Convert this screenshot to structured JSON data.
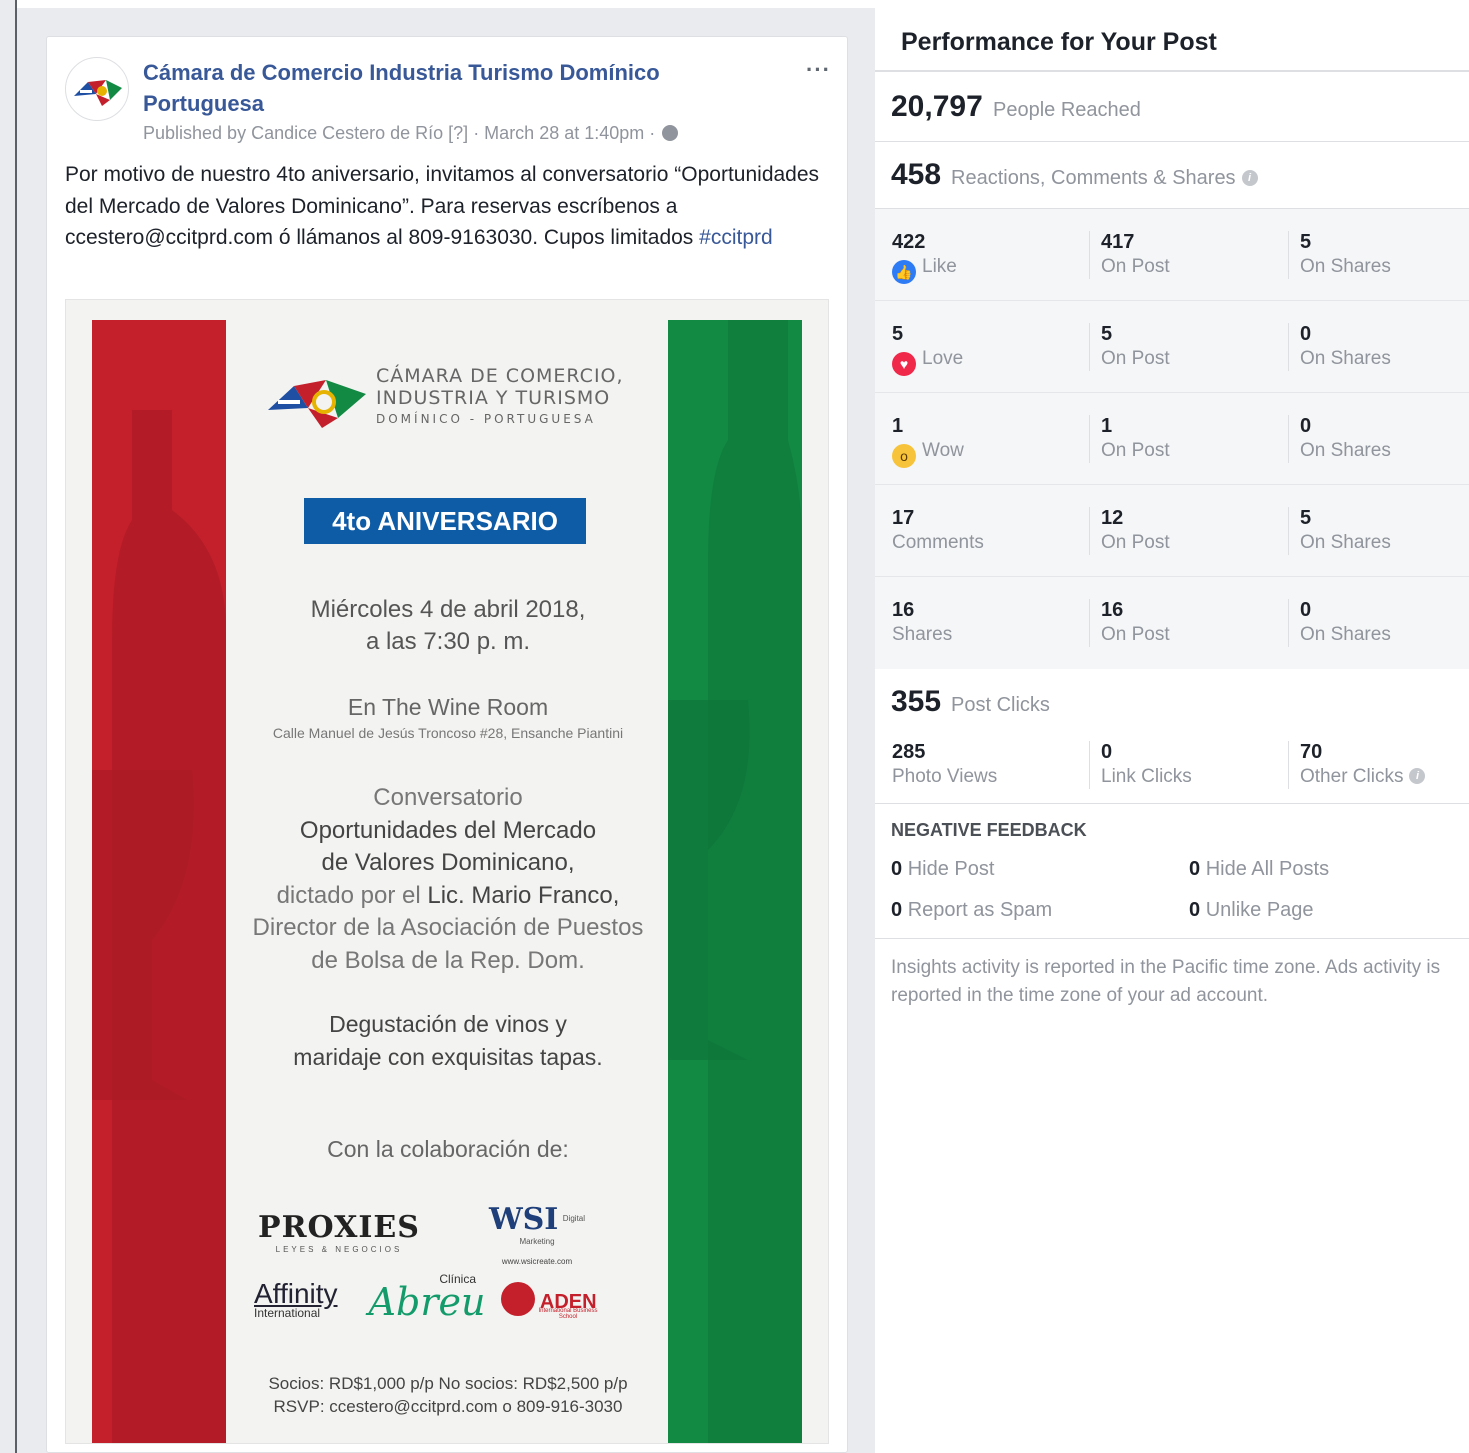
{
  "post": {
    "page_name": "Cámara de Comercio Industria Turismo Domínico Portuguesa",
    "published_by": "Published by Candice Cestero de Río [?] · March 28 at 1:40pm · ",
    "more_label": "···",
    "text": "Por motivo de nuestro 4to aniversario, invitamos al conversatorio “Oportunidades del Mercado de Valores Dominicano”. Para reservas escríbenos a ccestero@ccitprd.com ó llámanos al 809-9163030. Cupos limitados ",
    "hashtag": "#ccitprd",
    "flyer": {
      "chamber_l1": "CÁMARA DE COMERCIO,",
      "chamber_l2": "INDUSTRIA Y TURISMO",
      "chamber_l3": "DOMÍNICO - PORTUGUESA",
      "anniversary": "4to ANIVERSARIO",
      "date_l1": "Miércoles 4 de abril 2018,",
      "date_l2": "a las 7:30 p. m.",
      "venue_l1": "En The Wine Room",
      "venue_l2": "Calle Manuel de Jesús Troncoso #28, Ensanche Piantini",
      "talk_l1": "Conversatorio",
      "talk_l2": "Oportunidades del Mercado",
      "talk_l3": "de Valores Dominicano,",
      "talk_l4a": "dictado por el ",
      "talk_l4b": "Lic. Mario Franco,",
      "talk_l5": "Director de la Asociación de Puestos",
      "talk_l6": "de Bolsa de la Rep. Dom.",
      "tasting_l1": "Degustación de vinos y",
      "tasting_l2": "maridaje con exquisitas tapas.",
      "collab": "Con la colaboración de:",
      "sponsor_proxies": "PROXIES",
      "sponsor_proxies_sub": "LEYES & NEGOCIOS",
      "sponsor_wsi": "WSI",
      "sponsor_wsi_sub": "Digital Marketing",
      "sponsor_wsi_url": "www.wsicreate.com",
      "sponsor_affinity": "Affinity",
      "sponsor_affinity_sub": "International",
      "sponsor_abreu_small": "Clínica",
      "sponsor_abreu": "Abreu",
      "sponsor_aden": "ADEN",
      "sponsor_aden_sub": "International Business School",
      "prices": "Socios: RD$1,000 p/p No socios: RD$2,500 p/p",
      "rsvp": "RSVP: ccestero@ccitprd.com o 809-916-3030"
    }
  },
  "performance": {
    "title": "Performance for Your Post",
    "reached_num": "20,797",
    "reached_label": "People Reached",
    "rcs_num": "458",
    "rcs_label": "Reactions, Comments & Shares",
    "rows": [
      {
        "n1": "422",
        "l1": "Like",
        "icon": "like",
        "n2": "417",
        "l2": "On Post",
        "n3": "5",
        "l3": "On Shares"
      },
      {
        "n1": "5",
        "l1": "Love",
        "icon": "love",
        "n2": "5",
        "l2": "On Post",
        "n3": "0",
        "l3": "On Shares"
      },
      {
        "n1": "1",
        "l1": "Wow",
        "icon": "wow",
        "n2": "1",
        "l2": "On Post",
        "n3": "0",
        "l3": "On Shares"
      },
      {
        "n1": "17",
        "l1": "Comments",
        "icon": "",
        "n2": "12",
        "l2": "On Post",
        "n3": "5",
        "l3": "On Shares"
      },
      {
        "n1": "16",
        "l1": "Shares",
        "icon": "",
        "n2": "16",
        "l2": "On Post",
        "n3": "0",
        "l3": "On Shares"
      }
    ],
    "clicks_num": "355",
    "clicks_label": "Post Clicks",
    "photo_views_num": "285",
    "photo_views_label": "Photo Views",
    "link_clicks_num": "0",
    "link_clicks_label": "Link Clicks",
    "other_clicks_num": "70",
    "other_clicks_label": "Other Clicks",
    "negative_title": "NEGATIVE FEEDBACK",
    "hide_post_num": "0",
    "hide_post_label": "Hide Post",
    "hide_all_num": "0",
    "hide_all_label": "Hide All Posts",
    "spam_num": "0",
    "spam_label": "Report as Spam",
    "unlike_num": "0",
    "unlike_label": "Unlike Page",
    "footnote": "Insights activity is reported in the Pacific time zone. Ads activity is reported in the time zone of your ad account."
  },
  "colors": {
    "link_blue": "#385898",
    "flag_red": "#c4202b",
    "flag_green": "#128a44",
    "anniv_blue": "#0e5ba6"
  }
}
